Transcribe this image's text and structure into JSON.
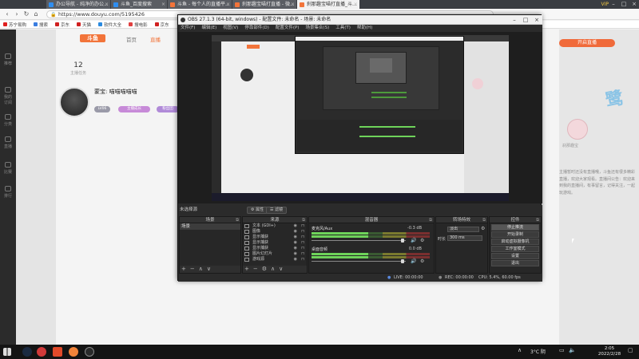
{
  "browser": {
    "tabs": [
      {
        "label": "办公导航 - 纯净的办公..."
      },
      {
        "label": "斗鱼_百度搜索"
      },
      {
        "label": "斗鱼 - 每个人的直播平..."
      },
      {
        "label": "刹那趣宝喵打直播 - 微..."
      },
      {
        "label": "刹那趣宝喵打直播_斗..."
      }
    ],
    "vip_label": "VIP",
    "url": "https://www.douyu.com/5195426",
    "bookmarks": [
      "苏宁易购",
      "搜索",
      "京东",
      "天猫",
      "软件大全",
      "搜电影",
      "京东"
    ]
  },
  "douyu": {
    "logo": "斗鱼",
    "nav": [
      "首页",
      "直播"
    ],
    "task_count": "12",
    "task_label": "主播任务",
    "anchor_name": "蒙宝: 喵喵喵喵喵",
    "pills": [
      "LV06",
      "主播成长",
      "粉丝团"
    ],
    "left_nav": [
      "推荐",
      "我的订阅",
      "分类",
      "直播",
      "比赛",
      "排行"
    ],
    "right_button": "开启直播",
    "right_avatar_caption": "刹那趣宝",
    "right_text": "主播暂时还没有直播哦，斗鱼还有很多精彩直播，欢迎大家观看。直播间公告：欢迎来到我的直播间，有事留言，记得关注，一起玩游戏。"
  },
  "obs": {
    "title": "OBS 27.1.3 (64-bit, windows) - 配置文件: 未命名 - 场景: 未命名",
    "menu": [
      "文件(F)",
      "编辑(E)",
      "视图(V)",
      "停靠部件(D)",
      "配置文件(P)",
      "场景集合(S)",
      "工具(T)",
      "帮助(H)"
    ],
    "scene_tab": "未选择源",
    "props_button": "属性",
    "filters_button": "滤镜",
    "docks": {
      "scenes": {
        "title": "场景",
        "items": [
          "场景"
        ]
      },
      "sources": {
        "title": "来源",
        "items": [
          "文本 (GDI+)",
          "图像",
          "显示捕获",
          "显示捕获",
          "显示捕获",
          "图片幻灯片",
          "游戏源"
        ]
      },
      "mixer": {
        "title": "混音器",
        "channels": [
          {
            "name": "麦克风/Aux",
            "db": "-0.3 dB"
          },
          {
            "name": "桌面音频",
            "db": "0.0 dB"
          }
        ]
      },
      "transitions": {
        "title": "转场特效",
        "type": "淡出",
        "duration_label": "时长",
        "duration": "300 ms"
      },
      "controls": {
        "title": "控件",
        "buttons": [
          "停止推流",
          "开始录制",
          "启动虚拟摄像机",
          "工作室模式",
          "设置",
          "退出"
        ]
      }
    },
    "status": {
      "live": "LIVE: 00:00:00",
      "rec": "REC: 00:00:00",
      "cpu": "CPU: 5.4%, 60.00 fps"
    }
  },
  "taskbar": {
    "weather": "3°C 阴",
    "time": "2:05",
    "date": "2022/2/28"
  },
  "colors": {
    "accent": "#f06a3a",
    "obs_bg": "#2b2b2b",
    "meter_green": "#6ed35a"
  }
}
